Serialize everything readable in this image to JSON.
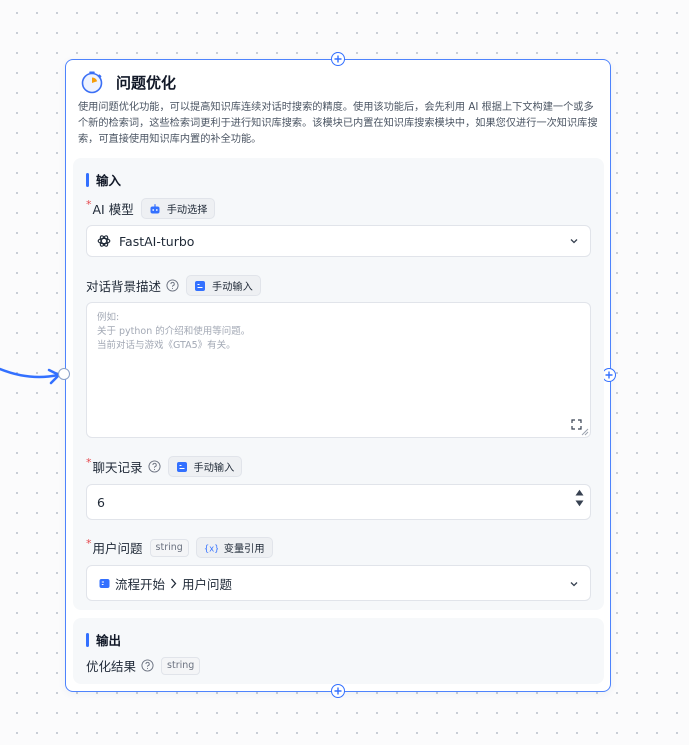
{
  "node": {
    "title": "问题优化",
    "description": "使用问题优化功能，可以提高知识库连续对话时搜索的精度。使用该功能后，会先利用 AI 根据上下文构建一个或多个新的检索词，这些检索词更利于进行知识库搜索。该模块已内置在知识库搜索模块中，如果您仅进行一次知识库搜索，可直接使用知识库内置的补全功能。"
  },
  "input_section": {
    "title": "输入",
    "model": {
      "label": "AI 模型",
      "required_mark": "*",
      "mode_tag": "手动选择",
      "value": "FastAI-turbo"
    },
    "background": {
      "label": "对话背景描述",
      "mode_tag": "手动输入",
      "placeholder": "例如:\n关于 python 的介绍和使用等问题。\n当前对话与游戏《GTA5》有关。"
    },
    "history": {
      "label": "聊天记录",
      "required_mark": "*",
      "mode_tag": "手动输入",
      "value": "6"
    },
    "user_question": {
      "label": "用户问题",
      "required_mark": "*",
      "type": "string",
      "mode_tag": "变量引用",
      "ref_source": "流程开始",
      "ref_field": "用户问题"
    }
  },
  "output_section": {
    "title": "输出",
    "result": {
      "label": "优化结果",
      "type": "string"
    }
  },
  "icons": {
    "header": "stopwatch-icon",
    "model_mode": "robot-icon",
    "input_mode": "keyboard-icon",
    "variable_mode": "variable-braces-icon",
    "model": "openai-icon",
    "ref": "flow-start-icon"
  },
  "colors": {
    "accent": "#3370ff",
    "node_border": "#4e83fd",
    "required": "#e5484d"
  }
}
